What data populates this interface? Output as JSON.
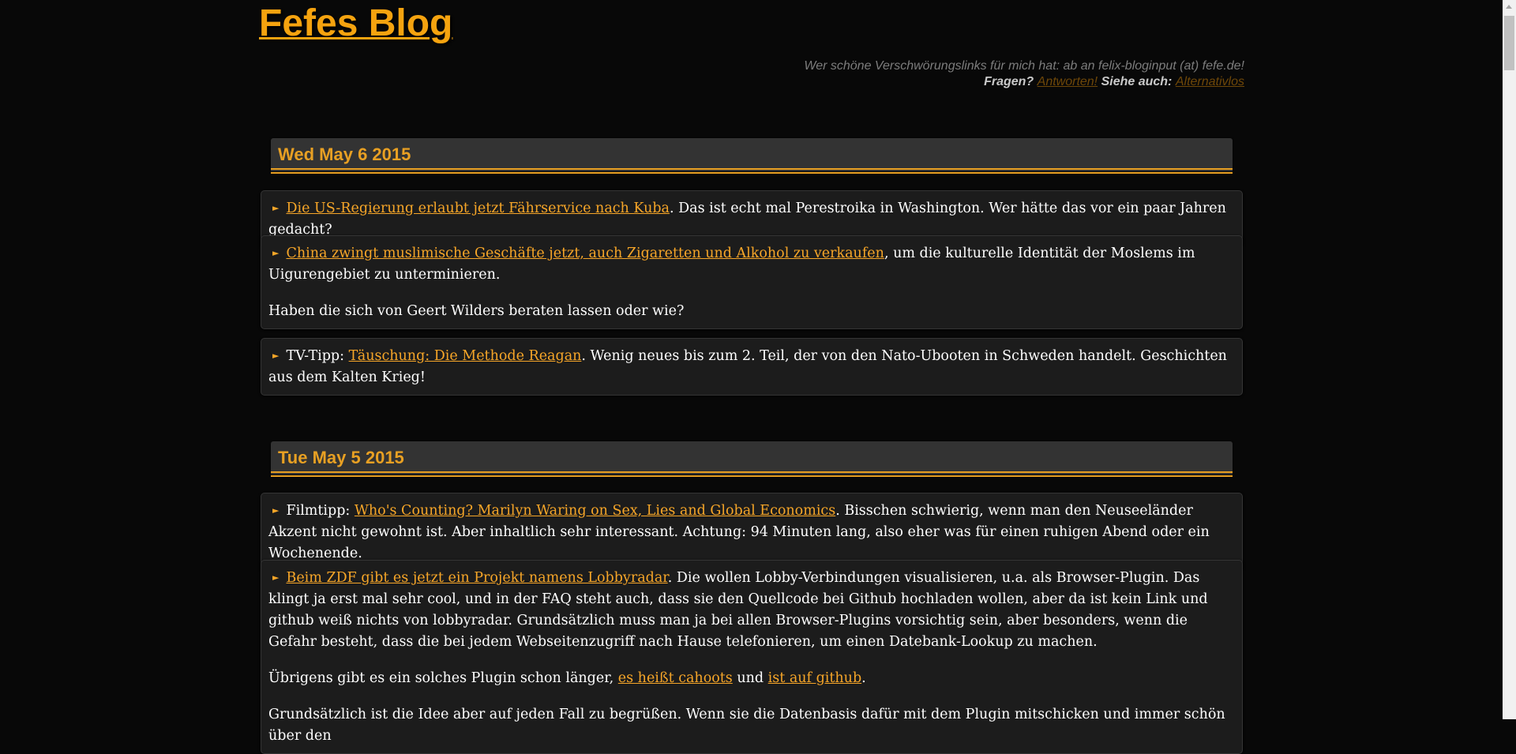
{
  "blog": {
    "title": "Fefes Blog",
    "tagline": "Wer schöne Verschwörungslinks für mich hat: ab an felix-bloginput (at) fefe.de!",
    "questions_label": "Fragen?",
    "answers_link": "Antworten!",
    "see_also_label": "Siehe auch:",
    "see_also_link": "Alternativlos"
  },
  "days": [
    {
      "date": "Wed May 6 2015",
      "posts": [
        {
          "link": "Die US-Regierung erlaubt jetzt Fährservice nach Kuba",
          "text": ". Das ist echt mal Perestroika in Washington. Wer hätte das vor ein paar Jahren gedacht?"
        },
        {
          "link": "China zwingt muslimische Geschäfte jetzt, auch Zigaretten und Alkohol zu verkaufen",
          "text": ", um die kulturelle Identität der Moslems im Uigurengebiet zu unterminieren.",
          "para2": "Haben die sich von Geert Wilders beraten lassen oder wie?"
        },
        {
          "prefix": "TV-Tipp: ",
          "link": "Täuschung: Die Methode Reagan",
          "text": ". Wenig neues bis zum 2. Teil, der von den Nato-Ubooten in Schweden handelt. Geschichten aus dem Kalten Krieg!"
        }
      ]
    },
    {
      "date": "Tue May 5 2015",
      "posts": [
        {
          "prefix": "Filmtipp: ",
          "link": "Who's Counting? Marilyn Waring on Sex, Lies and Global Economics",
          "text": ". Bisschen schwierig, wenn man den Neuseeländer Akzent nicht gewohnt ist. Aber inhaltlich sehr interessant. Achtung: 94 Minuten lang, also eher was für einen ruhigen Abend oder ein Wochenende."
        },
        {
          "link": "Beim ZDF gibt es jetzt ein Projekt namens Lobbyradar",
          "text": ". Die wollen Lobby-Verbindungen visualisieren, u.a. als Browser-Plugin. Das klingt ja erst mal sehr cool, und in der FAQ steht auch, dass sie den Quellcode bei Github hochladen wollen, aber da ist kein Link und github weiß nichts von lobbyradar. Grundsätzlich muss man ja bei allen Browser-Plugins vorsichtig sein, aber besonders, wenn die Gefahr besteht, dass die bei jedem Webseitenzugriff nach Hause telefonieren, um einen Datebank-Lookup zu machen.",
          "para2_start": "Übrigens gibt es ein solches Plugin schon länger, ",
          "para2_link1": "es heißt cahoots",
          "para2_mid": " und ",
          "para2_link2": "ist auf github",
          "para2_end": ".",
          "para3": "Grundsätzlich ist die Idee aber auf jeden Fall zu begrüßen. Wenn sie die Datenbasis dafür mit dem Plugin mitschicken und immer schön über den"
        }
      ]
    }
  ]
}
